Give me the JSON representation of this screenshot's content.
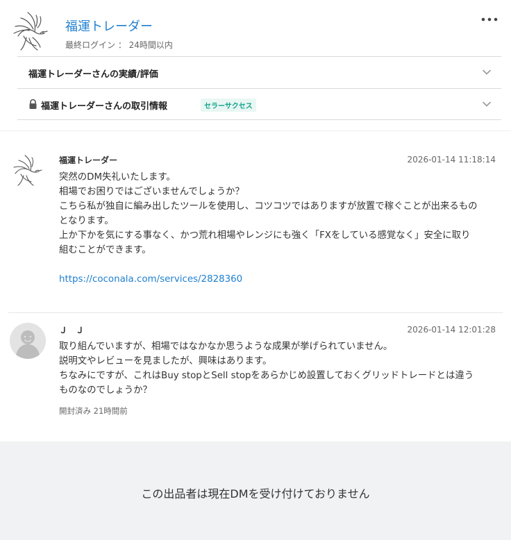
{
  "header": {
    "seller_name": "福運トレーダー",
    "last_login": "最終ログイン ： 24時間以内"
  },
  "accordions": {
    "record_title": "福運トレーダーさんの実績/評価",
    "trade_title": "福運トレーダーさんの取引情報",
    "trade_badge": "セラーサクセス"
  },
  "messages": [
    {
      "sender": "福運トレーダー",
      "timestamp": "2026-01-14 11:18:14",
      "lines": [
        "突然のDM失礼いたします。",
        "相場でお困りではございませんでしょうか？",
        "こちら私が独自に編み出したツールを使用し、コツコツではありますが放置で稼ぐことが出来るもの",
        "となります。",
        "上か下かを気にする事なく、かつ荒れ相場やレンジにも強く「FXをしている感覚なく」安全に取り",
        "組むことができます。"
      ],
      "link": "https://coconala.com/services/2828360"
    },
    {
      "sender": "Ｊ　Ｊ",
      "timestamp": "2026-01-14 12:01:28",
      "lines": [
        "取り組んでいますが、相場ではなかなか思うような成果が挙げられていません。",
        "説明文やレビューを見ましたが、興味はあります。",
        "ちなみにですが、これはBuy stopとSell stopをあらかじめ設置しておくグリッドトレードとは違う",
        "ものなのでしょうか？"
      ],
      "read_status": "開封済み 21時間前"
    }
  ],
  "footer": {
    "notice": "この出品者は現在DMを受け付けておりません"
  },
  "icons": {
    "seller_avatar": "dove-icon",
    "user_avatar": "default-user-icon",
    "menu": "more-dots-icon",
    "expand": "chevron-down-icon",
    "lock": "lock-icon"
  },
  "colors": {
    "link": "#1e7fd0",
    "badge_text": "#14a38b",
    "badge_bg": "#e8f7f3",
    "footer_bg": "#f1f2f3"
  }
}
